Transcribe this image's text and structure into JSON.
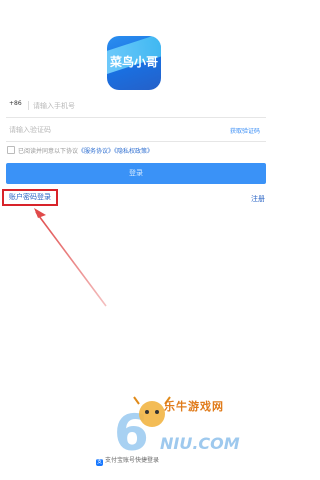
{
  "app": {
    "logo_text": "菜鸟小哥"
  },
  "form": {
    "phone_prefix": "+86",
    "phone_placeholder": "请输入手机号",
    "code_placeholder": "请输入验证码",
    "get_code_label": "获取验证码",
    "agreement_prefix": "已阅读并同意以下协议",
    "service_agreement": "《服务协议》",
    "privacy_policy": "《隐私权政策》",
    "login_button": "登录"
  },
  "links": {
    "password_login": "账户密码登录",
    "register": "注册",
    "alipay_login": "支付宝账号快捷登录"
  },
  "watermark": {
    "title": "乐牛游戏网",
    "domain": "NIU.COM"
  },
  "colors": {
    "accent": "#3a92f7",
    "link": "#2a64c5",
    "highlight": "#d8232a",
    "watermark": "#e07b1a"
  }
}
